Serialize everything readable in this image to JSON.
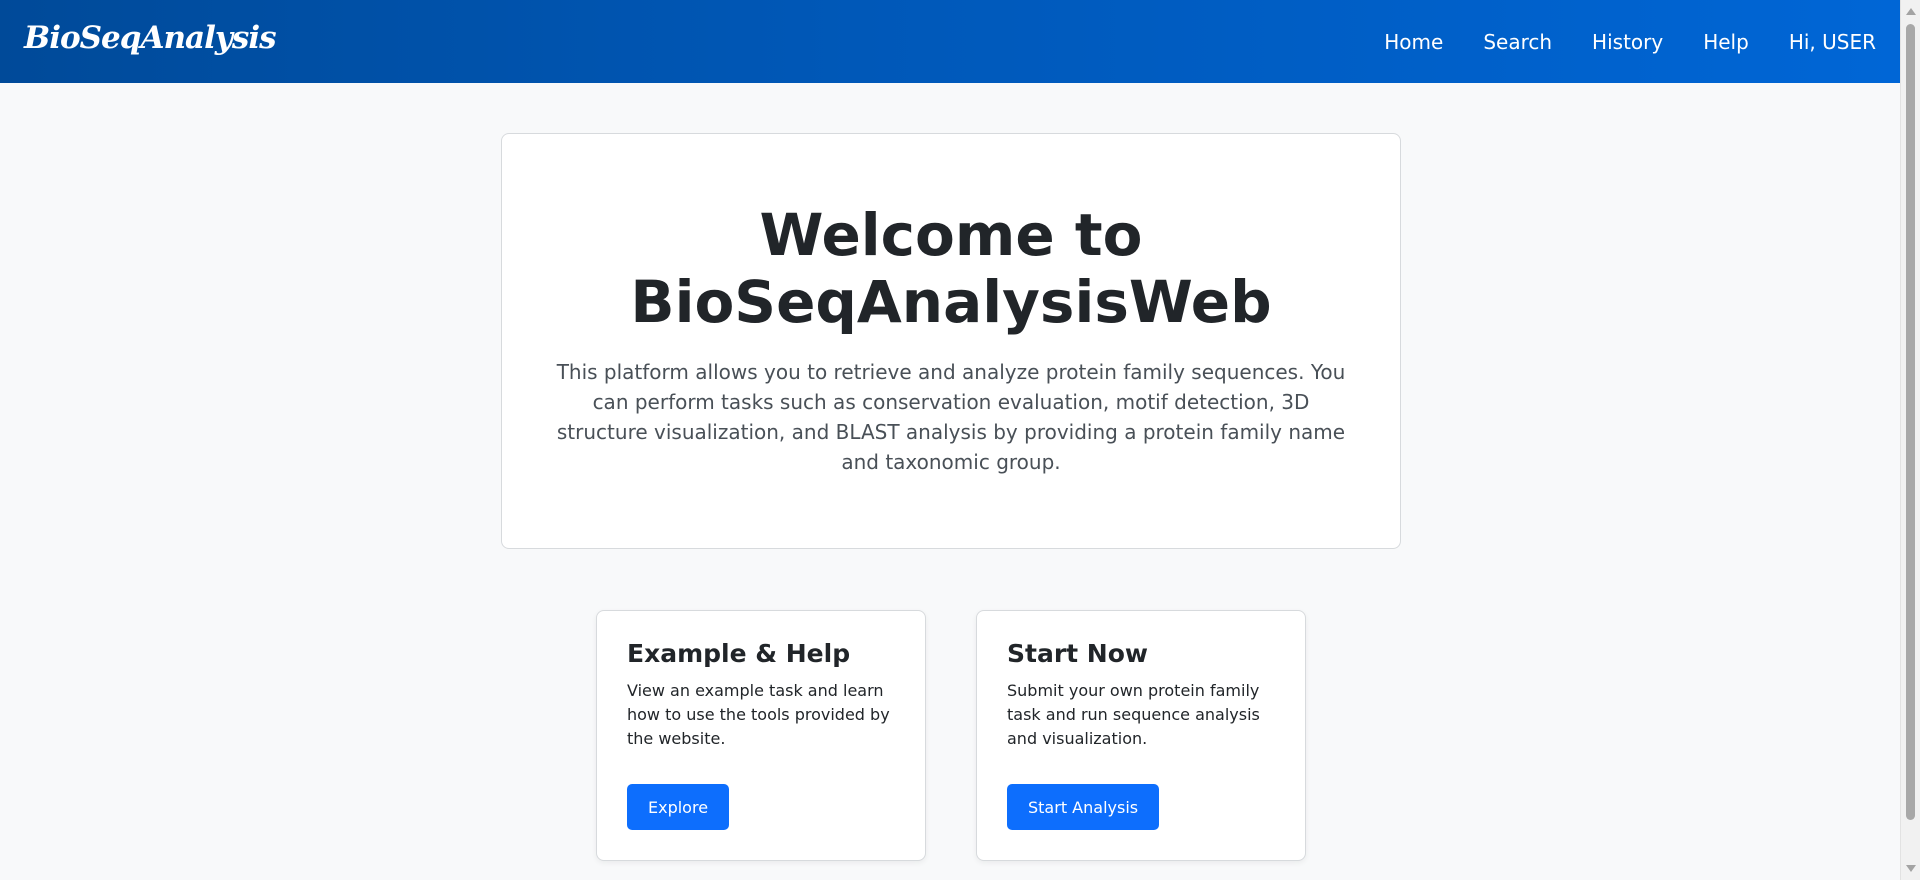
{
  "navbar": {
    "brand": "BioSeqAnalysis",
    "links": [
      "Home",
      "Search",
      "History",
      "Help"
    ],
    "user_greeting": "Hi, USER"
  },
  "hero": {
    "title_line1": "Welcome to",
    "title_line2": "BioSeqAnalysisWeb",
    "description": "This platform allows you to retrieve and analyze protein family sequences. You can perform tasks such as conservation evaluation, motif detection, 3D structure visualization, and BLAST analysis by providing a protein family name and taxonomic group."
  },
  "cards": {
    "help": {
      "title": "Example & Help",
      "text": "View an example task and learn how to use the tools provided by the website.",
      "button": "Explore"
    },
    "start": {
      "title": "Start Now",
      "text": "Submit your own protein family task and run sequence analysis and visualization.",
      "button": "Start Analysis"
    }
  },
  "colors": {
    "navbar_start": "#004a99",
    "navbar_end": "#0066d6",
    "button": "#0d6efd",
    "background": "#f8f9fa"
  }
}
